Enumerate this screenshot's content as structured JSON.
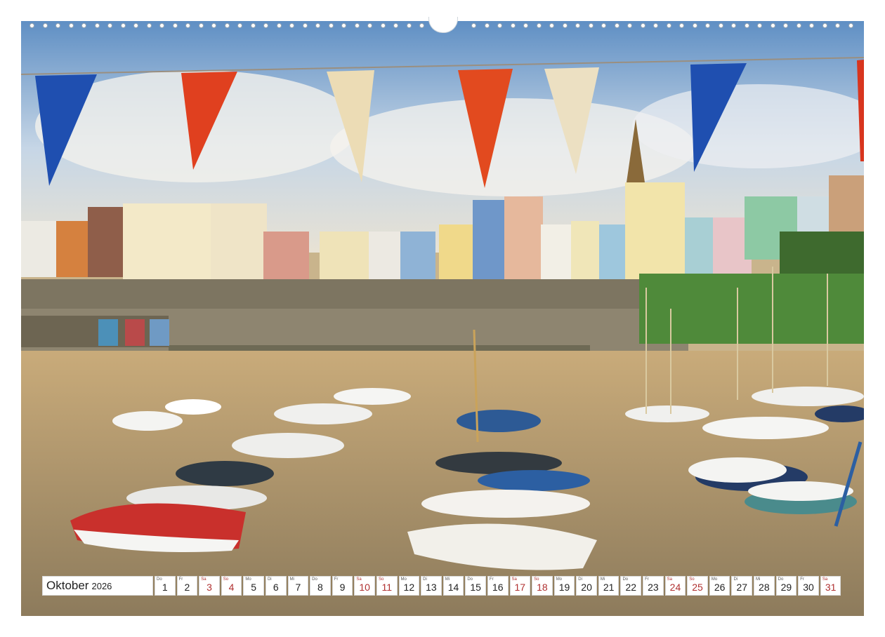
{
  "calendar": {
    "month": "Oktober",
    "year": "2026",
    "days": [
      {
        "dow": "Do",
        "num": "1",
        "type": "weekday"
      },
      {
        "dow": "Fr",
        "num": "2",
        "type": "weekday"
      },
      {
        "dow": "Sa",
        "num": "3",
        "type": "sat"
      },
      {
        "dow": "So",
        "num": "4",
        "type": "sun"
      },
      {
        "dow": "Mo",
        "num": "5",
        "type": "weekday"
      },
      {
        "dow": "Di",
        "num": "6",
        "type": "weekday"
      },
      {
        "dow": "Mi",
        "num": "7",
        "type": "weekday"
      },
      {
        "dow": "Do",
        "num": "8",
        "type": "weekday"
      },
      {
        "dow": "Fr",
        "num": "9",
        "type": "weekday"
      },
      {
        "dow": "Sa",
        "num": "10",
        "type": "sat"
      },
      {
        "dow": "So",
        "num": "11",
        "type": "sun"
      },
      {
        "dow": "Mo",
        "num": "12",
        "type": "weekday"
      },
      {
        "dow": "Di",
        "num": "13",
        "type": "weekday"
      },
      {
        "dow": "Mi",
        "num": "14",
        "type": "weekday"
      },
      {
        "dow": "Do",
        "num": "15",
        "type": "weekday"
      },
      {
        "dow": "Fr",
        "num": "16",
        "type": "weekday"
      },
      {
        "dow": "Sa",
        "num": "17",
        "type": "sat"
      },
      {
        "dow": "So",
        "num": "18",
        "type": "sun"
      },
      {
        "dow": "Mo",
        "num": "19",
        "type": "weekday"
      },
      {
        "dow": "Di",
        "num": "20",
        "type": "weekday"
      },
      {
        "dow": "Mi",
        "num": "21",
        "type": "weekday"
      },
      {
        "dow": "Do",
        "num": "22",
        "type": "weekday"
      },
      {
        "dow": "Fr",
        "num": "23",
        "type": "weekday"
      },
      {
        "dow": "Sa",
        "num": "24",
        "type": "sat"
      },
      {
        "dow": "So",
        "num": "25",
        "type": "sun"
      },
      {
        "dow": "Mo",
        "num": "26",
        "type": "weekday"
      },
      {
        "dow": "Di",
        "num": "27",
        "type": "weekday"
      },
      {
        "dow": "Mi",
        "num": "28",
        "type": "weekday"
      },
      {
        "dow": "Do",
        "num": "29",
        "type": "weekday"
      },
      {
        "dow": "Fr",
        "num": "30",
        "type": "weekday"
      },
      {
        "dow": "Sa",
        "num": "31",
        "type": "sat"
      }
    ]
  },
  "colors": {
    "sky": "#7fa6cf",
    "sand": "#c9ab7a",
    "flag_blue": "#1f4fb0",
    "flag_red": "#e0401f",
    "flag_cream": "#ecdcb5",
    "weekend_red": "#b03030"
  }
}
